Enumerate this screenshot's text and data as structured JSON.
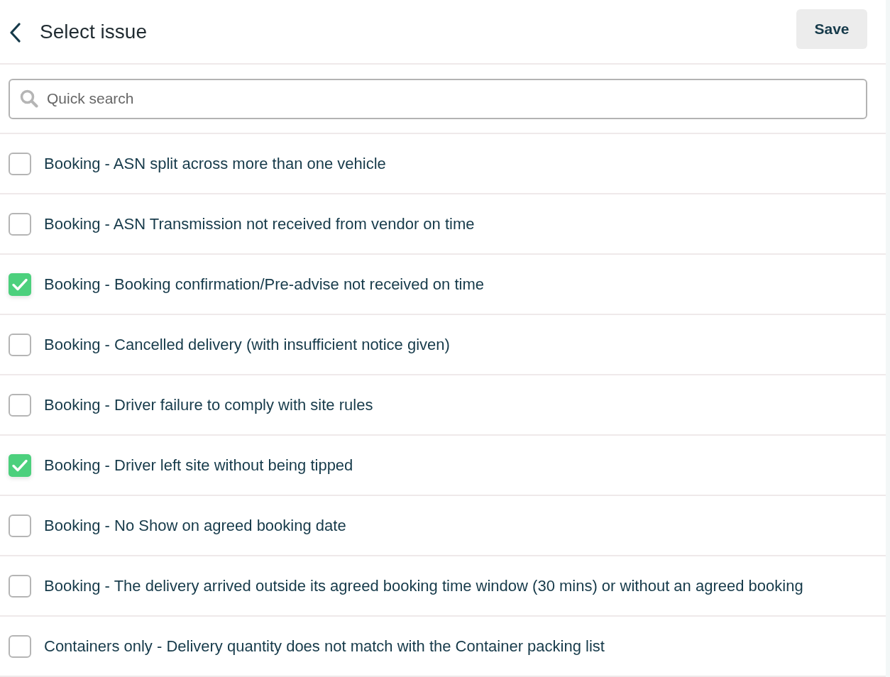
{
  "header": {
    "title": "Select issue",
    "save_button": "Save"
  },
  "search": {
    "placeholder": "Quick search"
  },
  "issues": [
    {
      "label": "Booking - ASN split across more than one vehicle",
      "checked": false
    },
    {
      "label": "Booking - ASN Transmission not received from vendor on time",
      "checked": false
    },
    {
      "label": "Booking - Booking confirmation/Pre-advise not received on time",
      "checked": true
    },
    {
      "label": "Booking - Cancelled delivery (with insufficient notice given)",
      "checked": false
    },
    {
      "label": "Booking - Driver failure to comply with site rules",
      "checked": false
    },
    {
      "label": "Booking - Driver left site without being tipped",
      "checked": true
    },
    {
      "label": "Booking - No Show on agreed booking date",
      "checked": false
    },
    {
      "label": "Booking - The delivery arrived outside its agreed booking time window (30 mins) or without an agreed booking",
      "checked": false
    },
    {
      "label": "Containers only - Delivery quantity does not match with the Container packing list",
      "checked": false
    }
  ]
}
